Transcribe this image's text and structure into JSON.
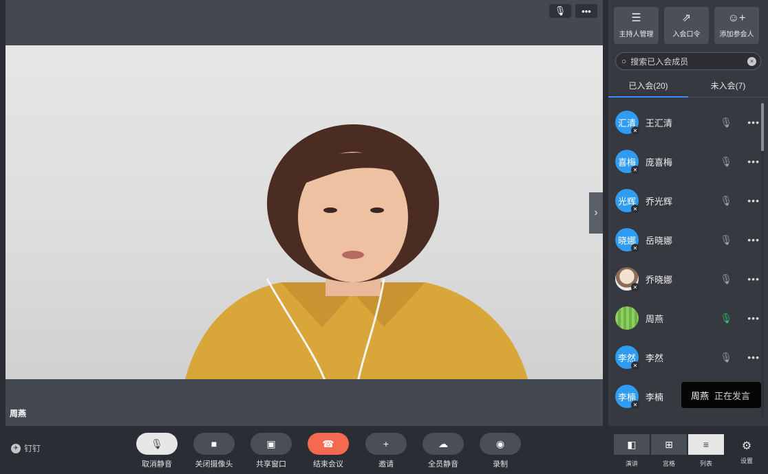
{
  "stage": {
    "speaker_name": "周燕",
    "top_controls": {
      "mic_glyph": "🎙",
      "more_glyph": "•••"
    },
    "collapse_glyph": "›"
  },
  "sidebar": {
    "host_actions": [
      {
        "label": "主持人管理",
        "icon": "sliders-icon",
        "glyph": "☰"
      },
      {
        "label": "入会口令",
        "icon": "share-link-icon",
        "glyph": "⇗"
      },
      {
        "label": "添加参会人",
        "icon": "add-user-icon",
        "glyph": "☺+"
      }
    ],
    "search": {
      "placeholder": "搜索已入会成员",
      "clear_glyph": "×"
    },
    "tabs": [
      {
        "label": "已入会(20)",
        "active": true
      },
      {
        "label": "未入会(7)",
        "active": false
      }
    ],
    "participants": [
      {
        "avatar_text": "汇清",
        "name": "王汇清",
        "mic_on": false
      },
      {
        "avatar_text": "喜梅",
        "name": "庞喜梅",
        "mic_on": false
      },
      {
        "avatar_text": "光辉",
        "name": "乔光辉",
        "mic_on": false
      },
      {
        "avatar_text": "晓娜",
        "name": "岳晓娜",
        "mic_on": false
      },
      {
        "avatar_text": "",
        "name": "乔晓娜",
        "mic_on": false,
        "photo": true
      },
      {
        "avatar_text": "",
        "name": "周燕",
        "mic_on": true,
        "photo": true
      },
      {
        "avatar_text": "李然",
        "name": "李然",
        "mic_on": false
      },
      {
        "avatar_text": "李楠",
        "name": "李楠",
        "mic_on": false
      }
    ],
    "more_glyph": "•••"
  },
  "tooltip": {
    "name": "周燕",
    "status": "正在发言"
  },
  "bottombar": {
    "brand": "钉钉",
    "controls": [
      {
        "label": "取消静音",
        "glyph": "🎙",
        "style": "light"
      },
      {
        "label": "关闭摄像头",
        "glyph": "■",
        "style": ""
      },
      {
        "label": "共享窗口",
        "glyph": "▣",
        "style": ""
      },
      {
        "label": "结束会议",
        "glyph": "☎",
        "style": "red"
      },
      {
        "label": "邀请",
        "glyph": "+",
        "style": ""
      },
      {
        "label": "全员静音",
        "glyph": "☁",
        "style": ""
      },
      {
        "label": "录制",
        "glyph": "◉",
        "style": ""
      }
    ],
    "layouts": [
      {
        "label": "演讲",
        "glyph": "◧",
        "active": false
      },
      {
        "label": "宫格",
        "glyph": "⊞",
        "active": false
      },
      {
        "label": "列表",
        "glyph": "≡",
        "active": true
      }
    ],
    "settings": {
      "label": "设置",
      "glyph": "⚙"
    }
  },
  "colors": {
    "accent": "#3c8bff",
    "end_call": "#f36a50",
    "mic_active": "#2fc36d",
    "avatar_blue": "#2f9cf2"
  }
}
